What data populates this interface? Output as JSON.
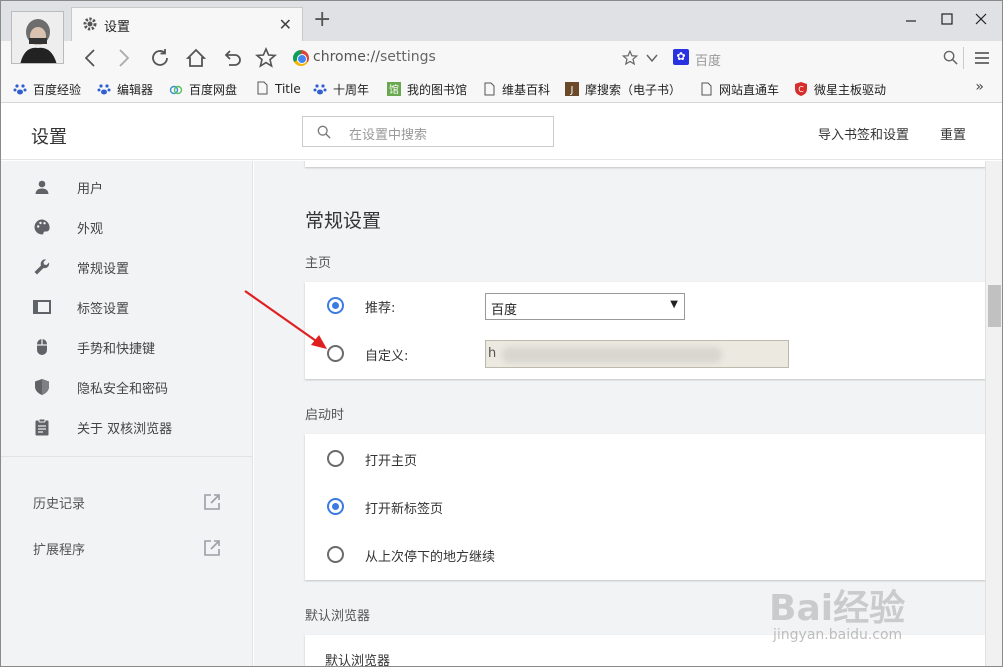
{
  "window": {
    "tab_title": "设置",
    "new_tab_symbol": "+",
    "omnibox": {
      "scheme": "chrome://",
      "host": "settings"
    },
    "search_engine_label": "百度"
  },
  "bookmarks": [
    {
      "label": "百度经验",
      "icon": "paw-icon"
    },
    {
      "label": "编辑器",
      "icon": "paw-icon"
    },
    {
      "label": "百度网盘",
      "icon": "cloud-icon"
    },
    {
      "label": "Title",
      "icon": "page-icon"
    },
    {
      "label": "十周年",
      "icon": "paw-icon"
    },
    {
      "label": "我的图书馆",
      "icon": "library-icon"
    },
    {
      "label": "维基百科",
      "icon": "page-icon"
    },
    {
      "label": "摩搜索（电子书）",
      "icon": "j-icon"
    },
    {
      "label": "网站直通车",
      "icon": "page-icon"
    },
    {
      "label": "微星主板驱动",
      "icon": "shield-red-icon"
    }
  ],
  "settings_header": {
    "title": "设置",
    "search_placeholder": "在设置中搜索",
    "import_label": "导入书签和设置",
    "reset_label": "重置"
  },
  "sidebar": {
    "items": [
      {
        "label": "用户",
        "icon": "person-icon"
      },
      {
        "label": "外观",
        "icon": "palette-icon"
      },
      {
        "label": "常规设置",
        "icon": "wrench-icon"
      },
      {
        "label": "标签设置",
        "icon": "tab-icon"
      },
      {
        "label": "手势和快捷键",
        "icon": "mouse-icon"
      },
      {
        "label": "隐私安全和密码",
        "icon": "shield-icon"
      },
      {
        "label": "关于 双核浏览器",
        "icon": "clipboard-icon"
      }
    ],
    "extras": [
      {
        "label": "历史记录",
        "icon": "external-link-icon"
      },
      {
        "label": "扩展程序",
        "icon": "external-link-icon"
      }
    ]
  },
  "general": {
    "title": "常规设置",
    "homepage": {
      "label": "主页",
      "recommend_label": "推荐:",
      "recommend_value": "百度",
      "recommend_checked": true,
      "custom_label": "自定义:",
      "custom_value": "h",
      "custom_checked": false
    },
    "startup": {
      "label": "启动时",
      "options": [
        {
          "label": "打开主页",
          "checked": false
        },
        {
          "label": "打开新标签页",
          "checked": true
        },
        {
          "label": "从上次停下的地方继续",
          "checked": false
        }
      ]
    },
    "default_browser": {
      "label": "默认浏览器",
      "row_label": "默认浏览器"
    }
  },
  "watermark": {
    "text": "Bai经验",
    "url": "jingyan.baidu.com"
  },
  "colors": {
    "accent": "#3c7be0",
    "annotation_arrow": "#e02020"
  }
}
